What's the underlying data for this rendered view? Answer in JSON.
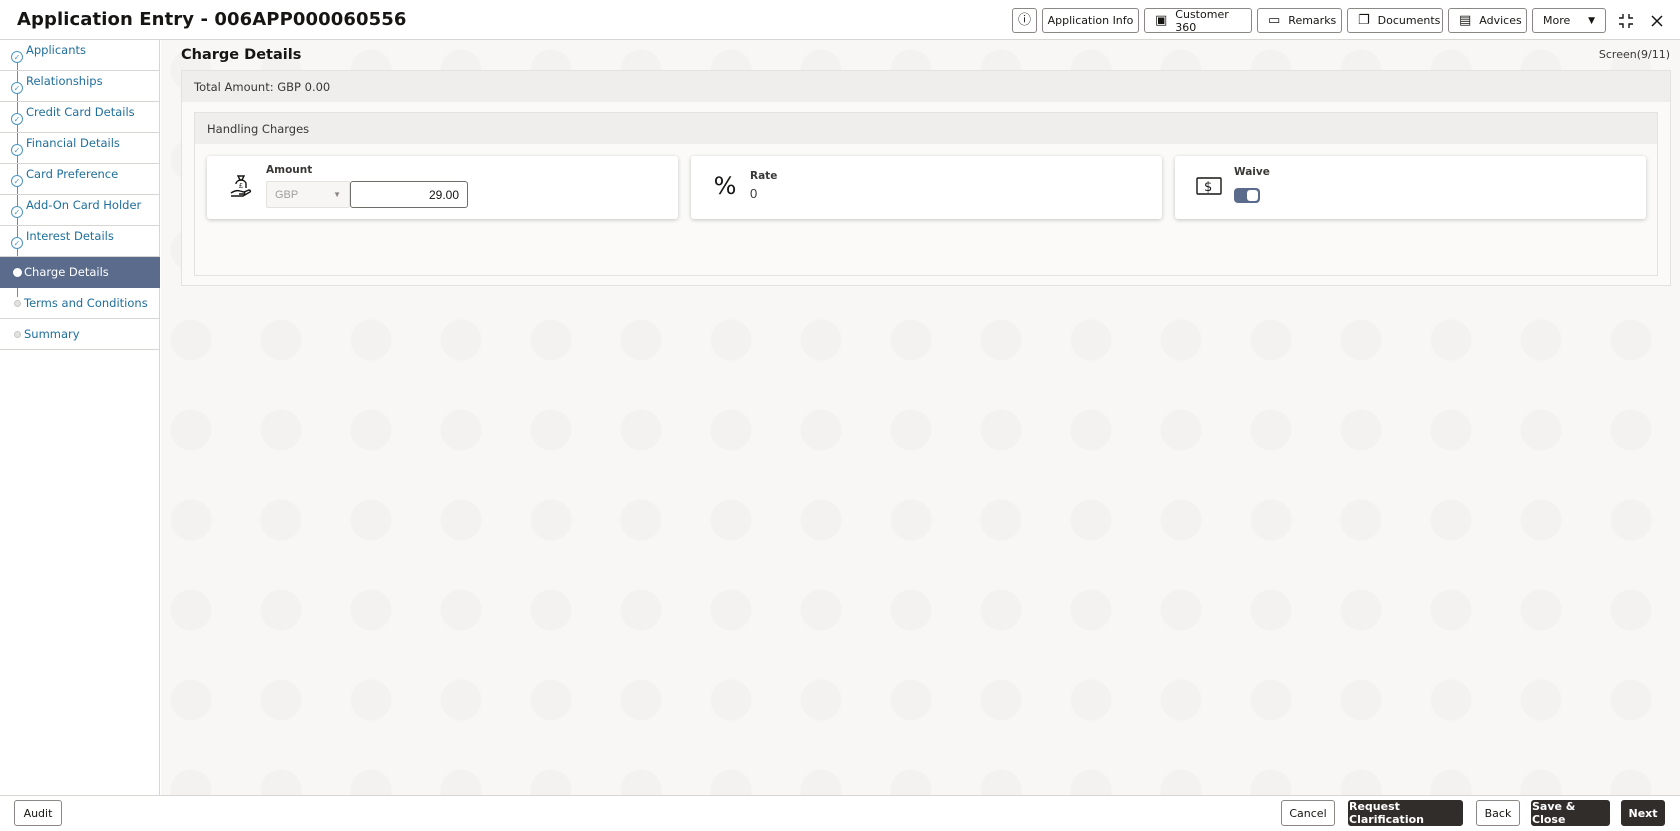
{
  "header": {
    "title": "Application Entry - 006APP000060556",
    "info_icon": "info-icon",
    "buttons": {
      "application_info": "Application Info",
      "customer_360": "Customer 360",
      "remarks": "Remarks",
      "documents": "Documents",
      "advices": "Advices",
      "more": "More"
    }
  },
  "sidebar": {
    "steps": [
      {
        "label": "Applicants",
        "state": "done"
      },
      {
        "label": "Relationships",
        "state": "done"
      },
      {
        "label": "Credit Card Details",
        "state": "done"
      },
      {
        "label": "Financial Details",
        "state": "done"
      },
      {
        "label": "Card Preference",
        "state": "done"
      },
      {
        "label": "Add-On Card Holder",
        "state": "done"
      },
      {
        "label": "Interest Details",
        "state": "done"
      },
      {
        "label": "Charge Details",
        "state": "active"
      },
      {
        "label": "Terms and Conditions",
        "state": "pending"
      },
      {
        "label": "Summary",
        "state": "pending"
      }
    ]
  },
  "main": {
    "title": "Charge Details",
    "screen_indicator": "Screen(9/11)",
    "total_amount": "Total Amount: GBP 0.00",
    "handling": {
      "title": "Handling Charges",
      "amount": {
        "label": "Amount",
        "currency": "GBP",
        "value": "29.00"
      },
      "rate": {
        "label": "Rate",
        "value": "0"
      },
      "waive": {
        "label": "Waive",
        "on": true
      }
    }
  },
  "footer": {
    "audit": "Audit",
    "cancel": "Cancel",
    "request_clarification": "Request Clarification",
    "back": "Back",
    "save_close": "Save & Close",
    "next": "Next"
  },
  "colors": {
    "accent": "#5a6b8c",
    "link": "#1f6f9c",
    "primary_button": "#312d2a"
  }
}
